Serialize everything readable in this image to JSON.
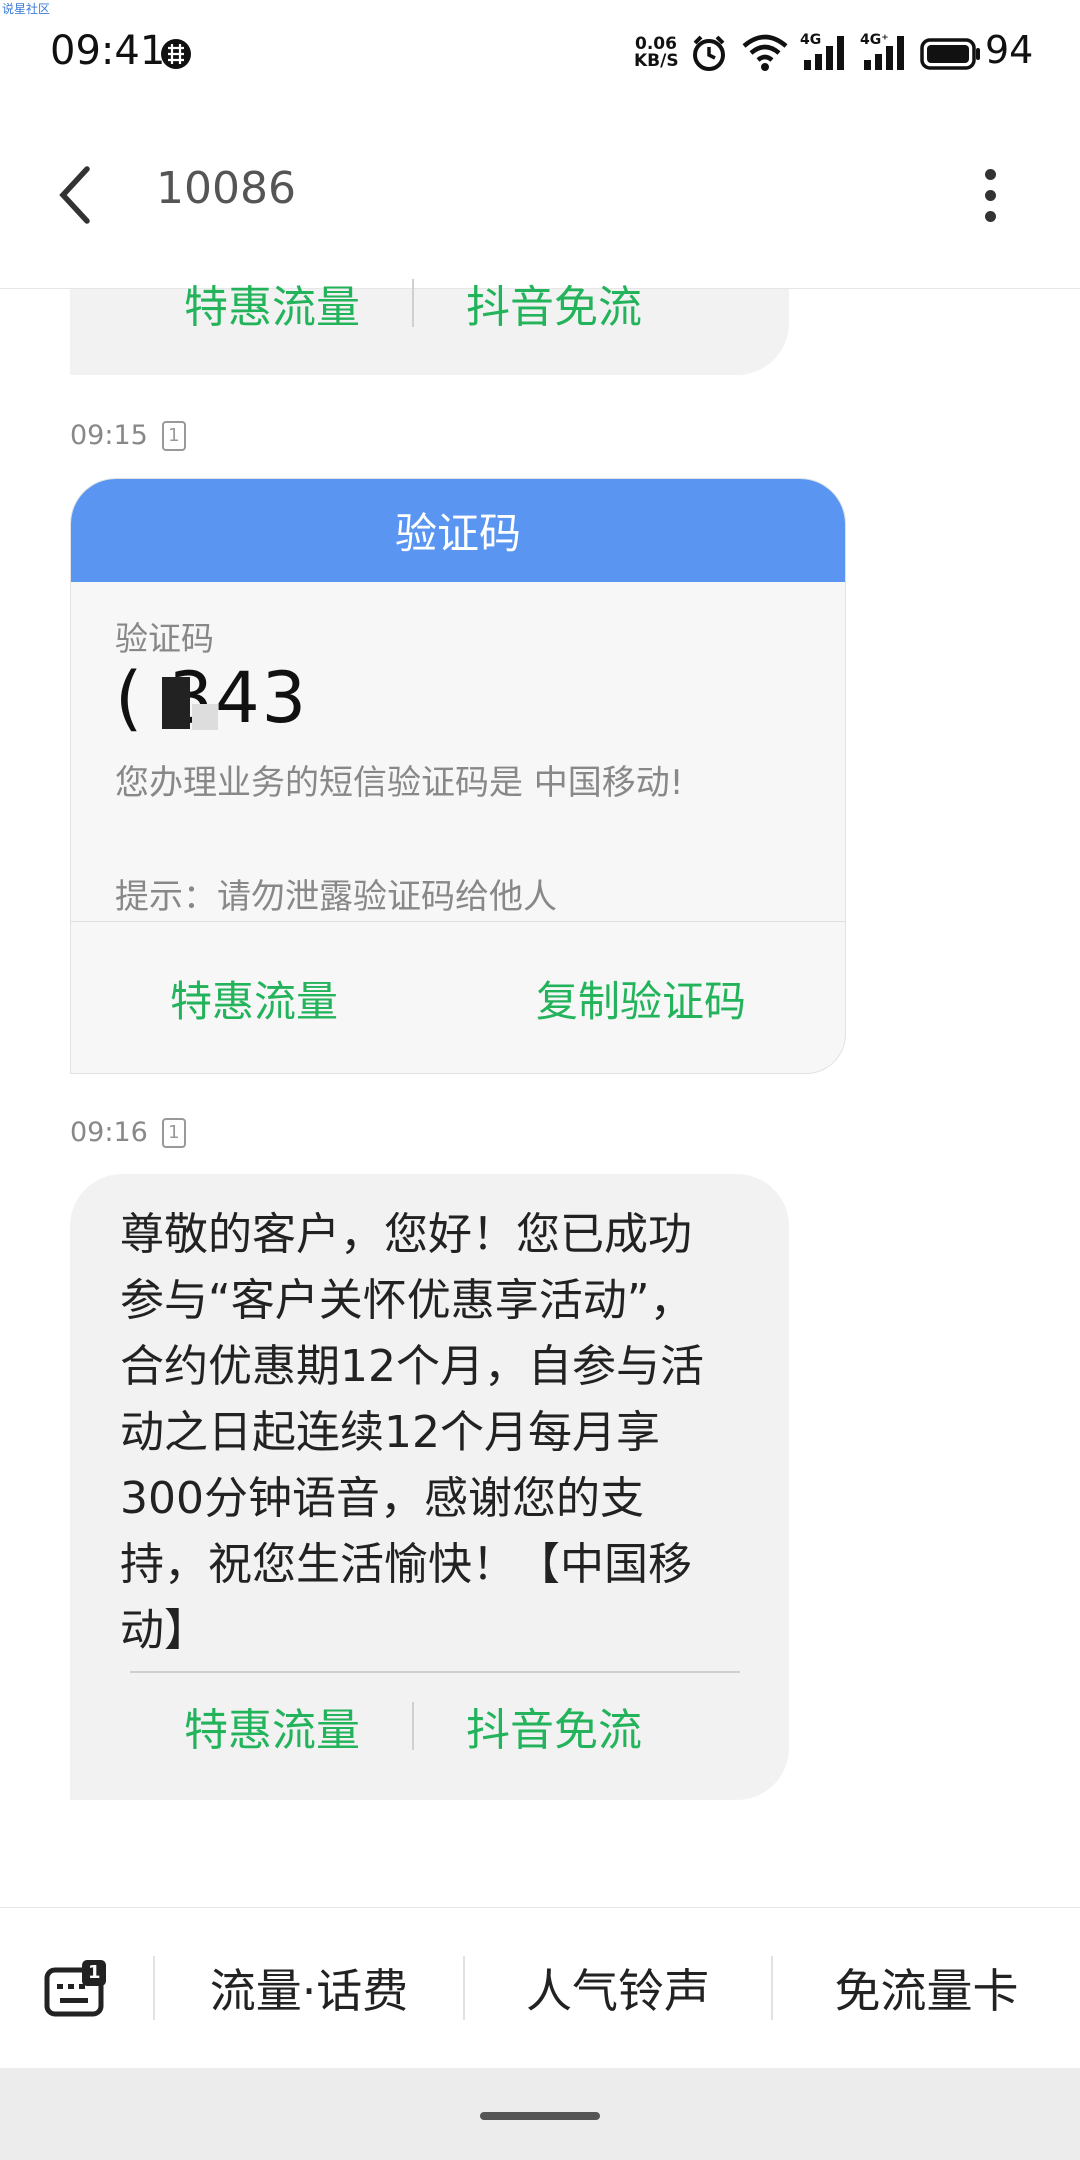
{
  "watermark": "说星社区",
  "status_bar": {
    "time": "09:41",
    "net_speed_value": "0.06",
    "net_speed_unit": "KB/S",
    "signal1_label": "4G",
    "signal2_label": "4G⁺",
    "battery": "94"
  },
  "header": {
    "title": "10086"
  },
  "conversation": {
    "top_partial_actions": [
      "特惠流量",
      "抖音免流"
    ],
    "otp_timestamp": "09:15",
    "sim_slot": "1",
    "otp_card": {
      "header": "验证码",
      "label": "验证码",
      "code": "(    343",
      "message": "您办理业务的短信验证码是            中国移动!",
      "hint": "提示：请勿泄露验证码给他人",
      "actions": [
        "特惠流量",
        "复制验证码"
      ]
    },
    "msg_timestamp": "09:16",
    "message": {
      "text": "尊敬的客户，您好！您已成功参与“客户关怀优惠享活动”，合约优惠期12个月，自参与活动之日起连续12个月每月享300分钟语音，感谢您的支持，祝您生活愉快！【中国移动】",
      "actions": [
        "特惠流量",
        "抖音免流"
      ]
    }
  },
  "menu_bar": {
    "keyboard_badge": "1",
    "items": [
      "流量·话费",
      "人气铃声",
      "免流量卡"
    ]
  },
  "colors": {
    "accent_green": "#23b35b",
    "card_header_blue": "#5b95f2"
  }
}
